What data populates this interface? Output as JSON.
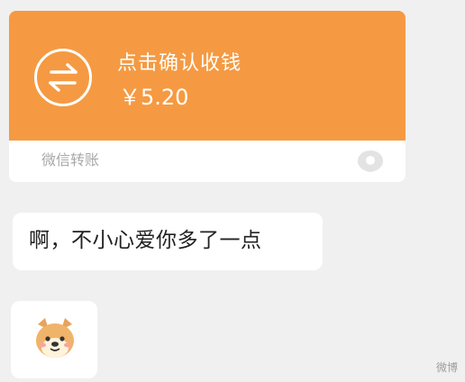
{
  "transfer": {
    "title": "点击确认收钱",
    "amount": "￥5.20",
    "label": "微信转账",
    "icon": "transfer-arrows-icon",
    "logo_icon": "wechat-pay-logo-icon",
    "colors": {
      "accent": "#f59a42",
      "card_bg": "#ffffff",
      "label_text": "#a8a8a8"
    }
  },
  "messages": [
    {
      "text": "啊，不小心爱你多了一点"
    },
    {
      "sticker": "shiba-dog-icon"
    }
  ],
  "watermark": "微博",
  "colors": {
    "chat_bg": "#f0f0f0",
    "bubble_bg": "#ffffff",
    "text": "#222222"
  }
}
